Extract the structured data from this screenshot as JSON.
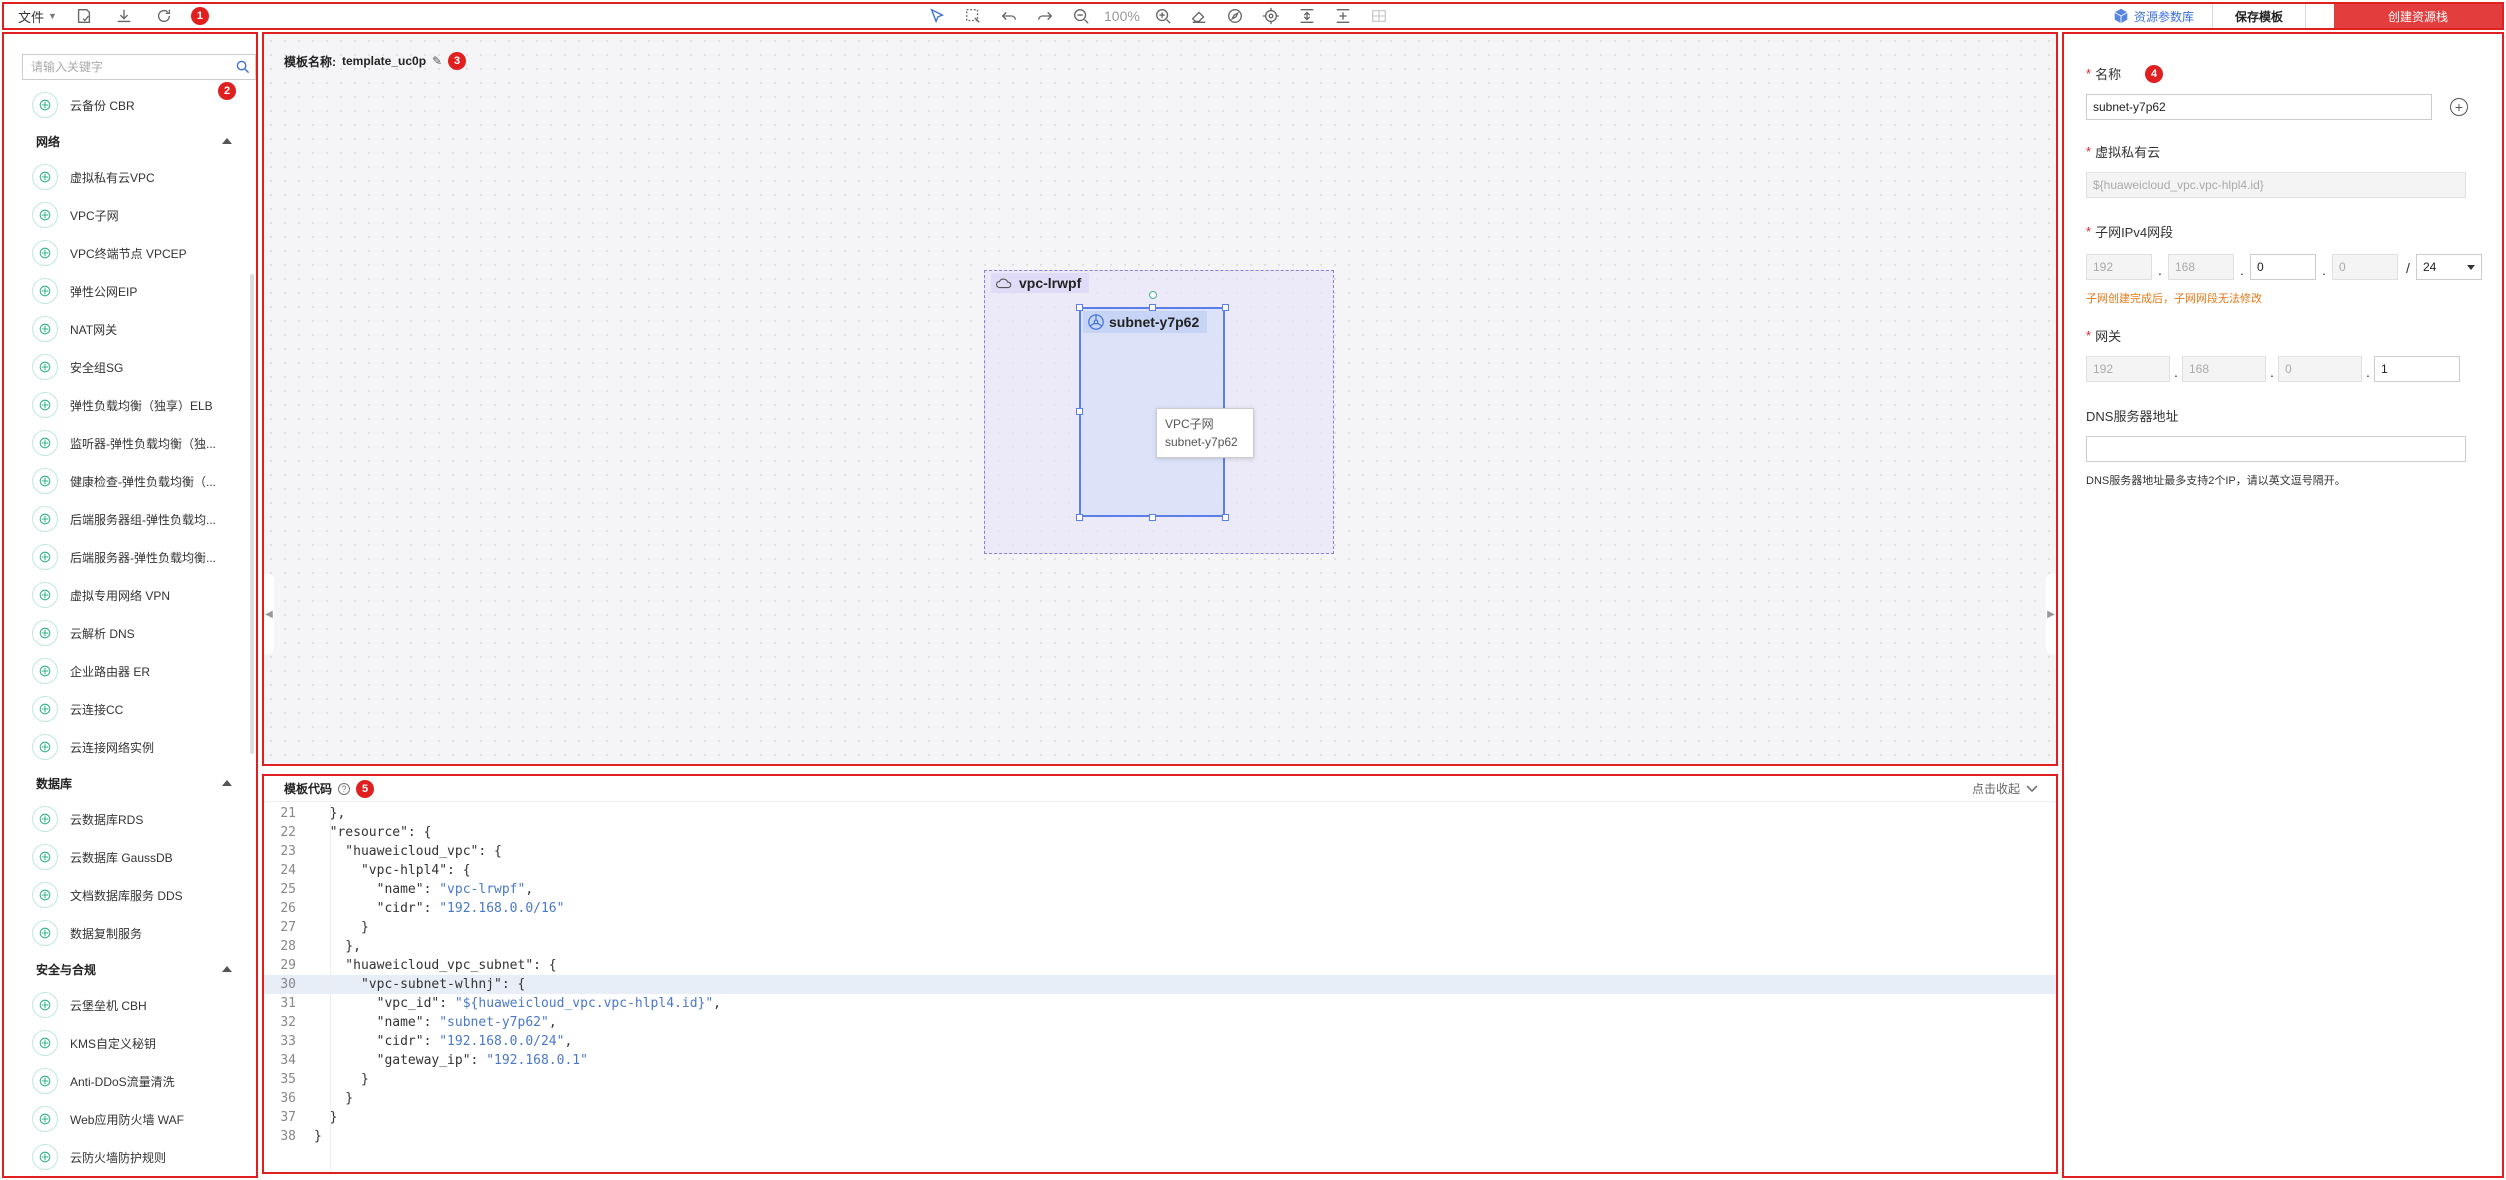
{
  "toolbar": {
    "file_label": "文件",
    "zoom_level": "100%",
    "badge": "1",
    "resource_lib_label": "资源参数库",
    "save_label": "保存模板",
    "create_label": "创建资源栈"
  },
  "sidebar": {
    "search_placeholder": "请输入关键字",
    "badge": "2",
    "items_top": [
      {
        "label": "云备份 CBR",
        "icon": "cloud-backup-icon"
      }
    ],
    "groups": [
      {
        "title": "网络",
        "items": [
          {
            "label": "虚拟私有云VPC",
            "icon": "vpc-icon"
          },
          {
            "label": "VPC子网",
            "icon": "subnet-icon"
          },
          {
            "label": "VPC终端节点 VPCEP",
            "icon": "vpcep-icon"
          },
          {
            "label": "弹性公网EIP",
            "icon": "eip-icon"
          },
          {
            "label": "NAT网关",
            "icon": "nat-gateway-icon"
          },
          {
            "label": "安全组SG",
            "icon": "security-group-icon"
          },
          {
            "label": "弹性负载均衡（独享）ELB",
            "icon": "elb-icon"
          },
          {
            "label": "监听器-弹性负载均衡（独...",
            "icon": "listener-icon"
          },
          {
            "label": "健康检查-弹性负载均衡（...",
            "icon": "health-check-icon"
          },
          {
            "label": "后端服务器组-弹性负载均...",
            "icon": "server-group-icon"
          },
          {
            "label": "后端服务器-弹性负载均衡...",
            "icon": "backend-server-icon"
          },
          {
            "label": "虚拟专用网络 VPN",
            "icon": "vpn-icon"
          },
          {
            "label": "云解析 DNS",
            "icon": "dns-icon"
          },
          {
            "label": "企业路由器 ER",
            "icon": "router-icon"
          },
          {
            "label": "云连接CC",
            "icon": "cloud-connect-icon"
          },
          {
            "label": "云连接网络实例",
            "icon": "network-instance-icon"
          }
        ]
      },
      {
        "title": "数据库",
        "items": [
          {
            "label": "云数据库RDS",
            "icon": "rds-icon"
          },
          {
            "label": "云数据库 GaussDB",
            "icon": "gaussdb-icon"
          },
          {
            "label": "文档数据库服务 DDS",
            "icon": "dds-icon"
          },
          {
            "label": "数据复制服务",
            "icon": "drs-icon"
          }
        ]
      },
      {
        "title": "安全与合规",
        "items": [
          {
            "label": "云堡垒机 CBH",
            "icon": "cbh-icon"
          },
          {
            "label": "KMS自定义秘钥",
            "icon": "kms-icon"
          },
          {
            "label": "Anti-DDoS流量清洗",
            "icon": "anti-ddos-icon"
          },
          {
            "label": "Web应用防火墙 WAF",
            "icon": "waf-icon"
          },
          {
            "label": "云防火墙防护规则",
            "icon": "firewall-icon"
          }
        ]
      }
    ]
  },
  "canvas": {
    "template_label": "模板名称:",
    "template_name": "template_uc0p",
    "badge": "3",
    "vpc_name": "vpc-lrwpf",
    "subnet_name": "subnet-y7p62",
    "tooltip_type": "VPC子网",
    "tooltip_name": "subnet-y7p62"
  },
  "code": {
    "title": "模板代码",
    "badge": "5",
    "collapse_label": "点击收起",
    "lines": [
      {
        "n": "21",
        "t": "  },"
      },
      {
        "n": "22",
        "t": "  \"resource\": {"
      },
      {
        "n": "23",
        "t": "    \"huaweicloud_vpc\": {"
      },
      {
        "n": "24",
        "t": "      \"vpc-hlpl4\": {"
      },
      {
        "n": "25",
        "t": "        \"name\": ",
        "s": "\"vpc-lrwpf\"",
        "e": ","
      },
      {
        "n": "26",
        "t": "        \"cidr\": ",
        "s": "\"192.168.0.0/16\"",
        "e": ""
      },
      {
        "n": "27",
        "t": "      }"
      },
      {
        "n": "28",
        "t": "    },"
      },
      {
        "n": "29",
        "t": "    \"huaweicloud_vpc_subnet\": {"
      },
      {
        "n": "30",
        "t": "      \"vpc-subnet-wlhnj\": {",
        "hl": true
      },
      {
        "n": "31",
        "t": "        \"vpc_id\": ",
        "s": "\"${huaweicloud_vpc.vpc-hlpl4.id}\"",
        "e": ","
      },
      {
        "n": "32",
        "t": "        \"name\": ",
        "s": "\"subnet-y7p62\"",
        "e": ","
      },
      {
        "n": "33",
        "t": "        \"cidr\": ",
        "s": "\"192.168.0.0/24\"",
        "e": ","
      },
      {
        "n": "34",
        "t": "        \"gateway_ip\": ",
        "s": "\"192.168.0.1\"",
        "e": ""
      },
      {
        "n": "35",
        "t": "      }"
      },
      {
        "n": "36",
        "t": "    }"
      },
      {
        "n": "37",
        "t": "  }"
      },
      {
        "n": "38",
        "t": "}"
      }
    ]
  },
  "props": {
    "badge": "4",
    "name_label": "名称",
    "name_value": "subnet-y7p62",
    "vpc_label": "虚拟私有云",
    "vpc_value": "${huaweicloud_vpc.vpc-hlpl4.id}",
    "cidr_label": "子网IPv4网段",
    "cidr_octets": [
      "192",
      "168",
      "0",
      "0"
    ],
    "cidr_mask": "24",
    "cidr_warning": "子网创建完成后，子网网段无法修改",
    "gateway_label": "网关",
    "gateway_octets": [
      "192",
      "168",
      "0",
      "1"
    ],
    "dns_label": "DNS服务器地址",
    "dns_value": "",
    "dns_hint": "DNS服务器地址最多支持2个IP，请以英文逗号隔开。"
  },
  "colors": {
    "accent_red": "#e33d3d",
    "link_blue": "#3a6fd8",
    "icon_green": "#2fb38a",
    "warning_orange": "#e07a1c"
  }
}
